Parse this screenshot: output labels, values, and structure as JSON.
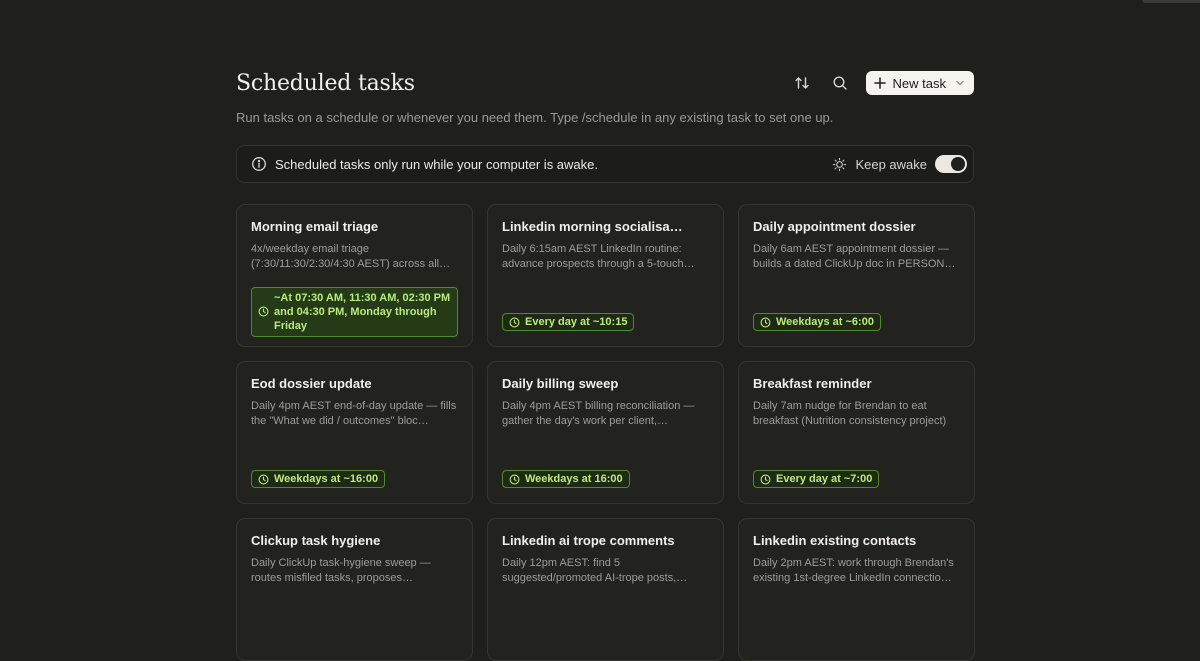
{
  "header": {
    "title": "Scheduled tasks",
    "subtitle": "Run tasks on a schedule or whenever you need them. Type /schedule in any existing task to set one up.",
    "new_task_label": "New task",
    "icons": [
      "sort-icon",
      "search-icon",
      "plus-icon",
      "chevron-down-icon"
    ]
  },
  "banner": {
    "message": "Scheduled tasks only run while your computer is awake.",
    "keep_awake_label": "Keep awake",
    "keep_awake_on": true
  },
  "colors": {
    "background": "#1f1f1c",
    "badge_border": "#4f8a2b",
    "badge_text": "#b9ea7e"
  },
  "tasks": [
    {
      "title": "Morning email triage",
      "description": "4x/weekday email triage (7:30/11:30/2:30/4:30 AEST) across all…",
      "schedule": "~At 07:30 AM, 11:30 AM, 02:30 PM and 04:30 PM, Monday through Friday"
    },
    {
      "title": "Linkedin morning socialisa…",
      "description": "Daily 6:15am AEST LinkedIn routine: advance prospects through a 5-touch…",
      "schedule": "Every day at ~10:15"
    },
    {
      "title": "Daily appointment dossier",
      "description": "Daily 6am AEST appointment dossier — builds a dated ClickUp doc in PERSON…",
      "schedule": "Weekdays at ~6:00"
    },
    {
      "title": "Eod dossier update",
      "description": "Daily 4pm AEST end-of-day update — fills the \"What we did / outcomes\" bloc…",
      "schedule": "Weekdays at ~16:00"
    },
    {
      "title": "Daily billing sweep",
      "description": "Daily 4pm AEST billing reconciliation — gather the day's work per client,…",
      "schedule": "Weekdays at 16:00"
    },
    {
      "title": "Breakfast reminder",
      "description": "Daily 7am nudge for Brendan to eat breakfast (Nutrition consistency project)",
      "schedule": "Every day at ~7:00"
    },
    {
      "title": "Clickup task hygiene",
      "description": "Daily ClickUp task-hygiene sweep — routes misfiled tasks, proposes…",
      "schedule": ""
    },
    {
      "title": "Linkedin ai trope comments",
      "description": "Daily 12pm AEST: find 5 suggested/promoted AI-trope posts,…",
      "schedule": ""
    },
    {
      "title": "Linkedin existing contacts",
      "description": "Daily 2pm AEST: work through Brendan's existing 1st-degree LinkedIn connectio…",
      "schedule": ""
    }
  ]
}
